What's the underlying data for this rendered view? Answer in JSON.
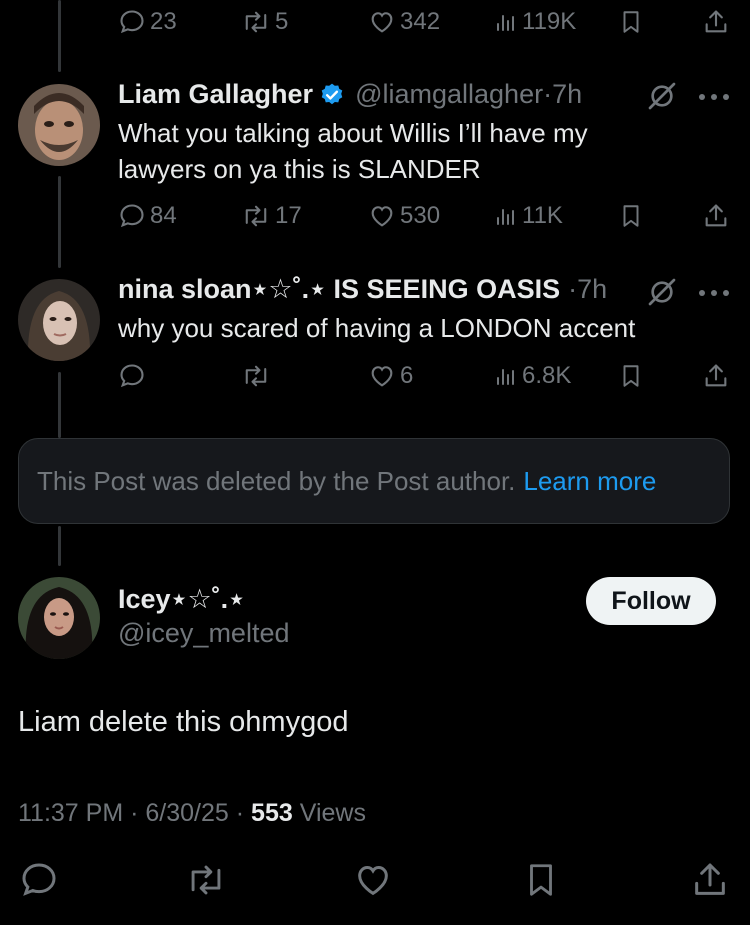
{
  "top_tweet": {
    "replies": "23",
    "reposts": "5",
    "likes": "342",
    "views": "119K"
  },
  "tweets": [
    {
      "name": "Liam Gallagher",
      "verified": true,
      "handle": "@liamgallagher",
      "time": "7h",
      "text_lines": [
        "What you talking about Willis I’ll have my",
        "lawyers on ya this is SLANDER"
      ],
      "replies": "84",
      "reposts": "17",
      "likes": "530",
      "views": "11K"
    },
    {
      "name": "nina sloan⋆☆˚.⋆ IS SEEING OASIS",
      "handle": "",
      "time": "7h",
      "text_lines": [
        "why you scared of having a LONDON accent"
      ],
      "replies": "",
      "reposts": "",
      "likes": "6",
      "views": "6.8K"
    }
  ],
  "deleted_notice": {
    "text": "This Post was deleted by the Post author.",
    "link": "Learn more"
  },
  "main_post": {
    "name": "Icey⋆☆˚.⋆",
    "handle": "@icey_melted",
    "follow_label": "Follow",
    "text": "Liam delete this ohmygod",
    "time": "11:37 PM",
    "date": "6/30/25",
    "views_count": "553",
    "views_label": "Views"
  },
  "colors": {
    "background": "#000000",
    "text": "#e7e9ea",
    "muted": "#71767b",
    "link": "#1d9bf0",
    "verified": "#1d9bf0"
  }
}
